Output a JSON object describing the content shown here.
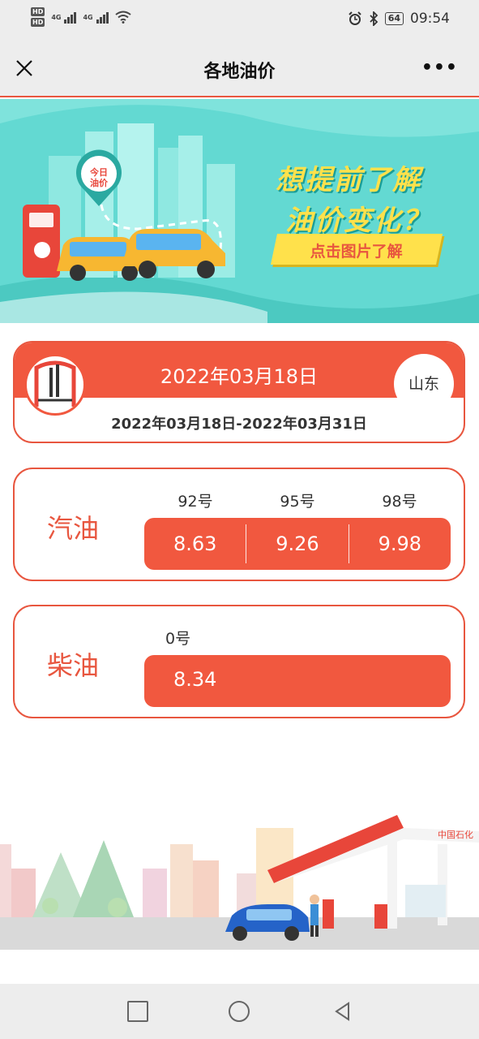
{
  "status_bar": {
    "hd1": "HD",
    "hd2": "HD",
    "net1": "4G",
    "net2": "4G",
    "battery": "64",
    "time": "09:54"
  },
  "nav": {
    "title": "各地油价",
    "close_icon": "close-icon",
    "more": "•••"
  },
  "banner": {
    "line1": "想提前了解",
    "line2": "油价变化？",
    "button": "点击图片了解",
    "sign": [
      "今日",
      "油价"
    ]
  },
  "header": {
    "date": "2022年03月18日",
    "province": "山东",
    "range": "2022年03月18日-2022年03月31日"
  },
  "gasoline": {
    "name": "汽油",
    "grades": [
      "92号",
      "95号",
      "98号"
    ],
    "prices": [
      "8.63",
      "9.26",
      "9.98"
    ]
  },
  "diesel": {
    "name": "柴油",
    "grade": "0号",
    "price": "8.34"
  },
  "station_sign": "中国石化",
  "colors": {
    "accent": "#f1583f",
    "banner_bg": "#63d9d2",
    "banner_text": "#ffe14b"
  }
}
